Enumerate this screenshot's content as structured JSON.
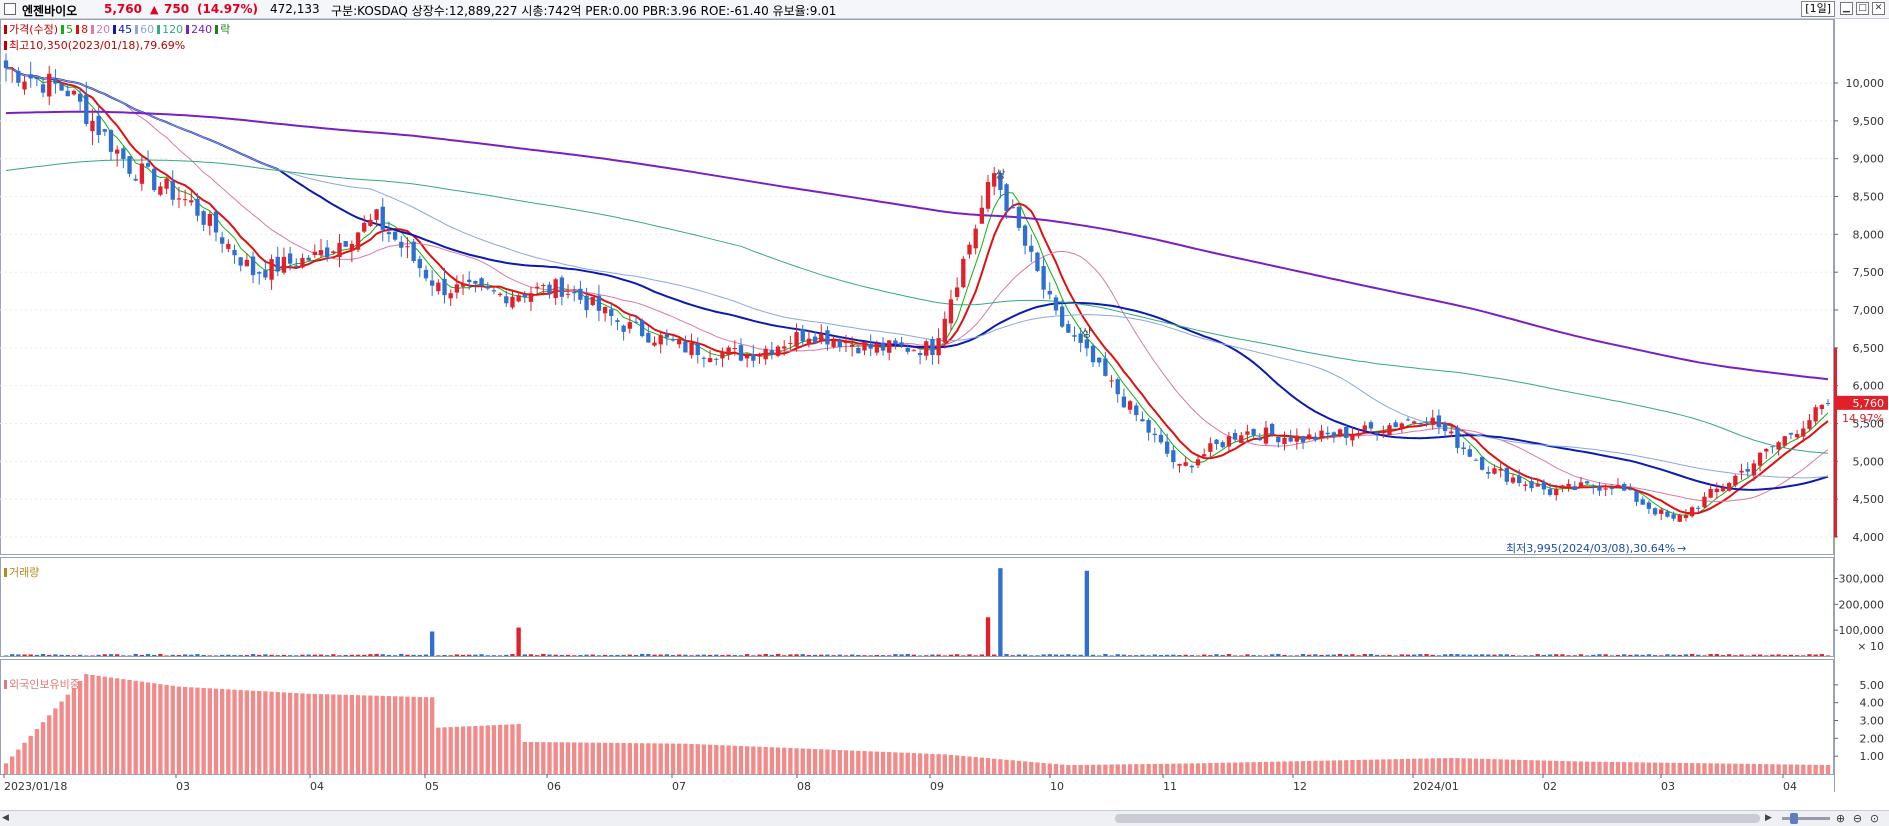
{
  "header": {
    "stock_name": "엔젠바이오",
    "price": "5,760",
    "arrow": "▲",
    "change": "750",
    "change_pct": "(14.97%)",
    "volume": "472,133",
    "info": "구분:KOSDAQ 상장수:12,889,227 시총:742억 PER:0.00 PBR:3.96 ROE:-61.40 유보율:9.01",
    "period": "[1일]"
  },
  "price_pane": {
    "legend": [
      {
        "text": "가격(수정)",
        "color": "#c00000"
      },
      {
        "text": "5",
        "color": "#11b111"
      },
      {
        "text": "8",
        "color": "#e01010"
      },
      {
        "text": "20",
        "color": "#d97aa8"
      },
      {
        "text": "45",
        "color": "#0a1bb0"
      },
      {
        "text": "60",
        "color": "#8aa8dd"
      },
      {
        "text": "120",
        "color": "#36a880"
      },
      {
        "text": "240",
        "color": "#7a20c0"
      },
      {
        "text": "락",
        "color": "#208020"
      }
    ],
    "high_annotation": "최고10,350(2023/01/18),79.69%",
    "low_annotation": "최저3,995(2024/03/08),30.64%",
    "upper_limit_marker": "상",
    "current_price_label": "5,760",
    "current_pct_label": "14.97%",
    "y_ticks": [
      "10,000",
      "9,500",
      "9,000",
      "8,500",
      "8,000",
      "7,500",
      "7,000",
      "6,500",
      "6,000",
      "5,500",
      "5,000",
      "4,500",
      "4,000"
    ]
  },
  "volume_pane": {
    "title": "거래량",
    "y_ticks": [
      "300,000",
      "200,000",
      "100,000"
    ],
    "unit": "× 10"
  },
  "foreign_pane": {
    "title": "외국인보유비중",
    "y_ticks": [
      "5.00",
      "4.00",
      "3.00",
      "2.00",
      "1.00"
    ]
  },
  "x_labels": [
    "2023/01/18",
    "03",
    "04",
    "05",
    "06",
    "07",
    "08",
    "09",
    "10",
    "11",
    "12",
    "2024/01",
    "02",
    "03",
    "04"
  ],
  "colors": {
    "up": "#e0202a",
    "down": "#2f6fd0",
    "foreign_bar": "#f28a8a",
    "grid": "#c8ccd4"
  },
  "chart_data": {
    "type": "candlestick",
    "period": "daily",
    "x_range": [
      "2023/01/18",
      "2024/04/02"
    ],
    "price_range": [
      3995,
      10350
    ],
    "price_series_close": [
      [
        "2023/01/18",
        10200
      ],
      [
        "2023/02/01",
        9900
      ],
      [
        "2023/02/15",
        8900
      ],
      [
        "2023/03/01",
        8400
      ],
      [
        "2023/03/15",
        7500
      ],
      [
        "2023/04/01",
        7700
      ],
      [
        "2023/04/15",
        8200
      ],
      [
        "2023/05/01",
        7300
      ],
      [
        "2023/05/15",
        7200
      ],
      [
        "2023/06/01",
        7300
      ],
      [
        "2023/06/15",
        6800
      ],
      [
        "2023/07/01",
        6500
      ],
      [
        "2023/07/15",
        6400
      ],
      [
        "2023/08/01",
        6700
      ],
      [
        "2023/08/15",
        6500
      ],
      [
        "2023/09/01",
        6500
      ],
      [
        "2023/09/15",
        8800
      ],
      [
        "2023/10/01",
        6900
      ],
      [
        "2023/10/15",
        5900
      ],
      [
        "2023/11/01",
        4900
      ],
      [
        "2023/11/15",
        5400
      ],
      [
        "2023/12/01",
        5300
      ],
      [
        "2023/12/15",
        5400
      ],
      [
        "2024/01/01",
        5600
      ],
      [
        "2024/01/15",
        4900
      ],
      [
        "2024/02/01",
        4600
      ],
      [
        "2024/02/15",
        4700
      ],
      [
        "2024/03/08",
        4200
      ],
      [
        "2024/03/20",
        4800
      ],
      [
        "2024/04/02",
        5760
      ]
    ],
    "volume_peaks": [
      [
        "2023/09/15",
        340000
      ],
      [
        "2023/09/12",
        150000
      ],
      [
        "2023/10/05",
        330000
      ],
      [
        "2023/05/01",
        95000
      ],
      [
        "2023/05/22",
        110000
      ]
    ],
    "foreign_ownership_pct": [
      [
        "2023/01/18",
        0.6
      ],
      [
        "2023/02/06",
        5.6
      ],
      [
        "2023/03/01",
        4.9
      ],
      [
        "2023/04/01",
        4.5
      ],
      [
        "2023/05/01",
        4.3
      ],
      [
        "2023/05/02",
        2.6
      ],
      [
        "2023/05/22",
        2.8
      ],
      [
        "2023/05/23",
        1.8
      ],
      [
        "2023/07/01",
        1.7
      ],
      [
        "2023/09/01",
        1.1
      ],
      [
        "2023/10/01",
        0.5
      ],
      [
        "2023/11/01",
        0.6
      ],
      [
        "2024/01/01",
        0.9
      ],
      [
        "2024/02/01",
        0.7
      ],
      [
        "2024/04/02",
        0.5
      ]
    ]
  }
}
